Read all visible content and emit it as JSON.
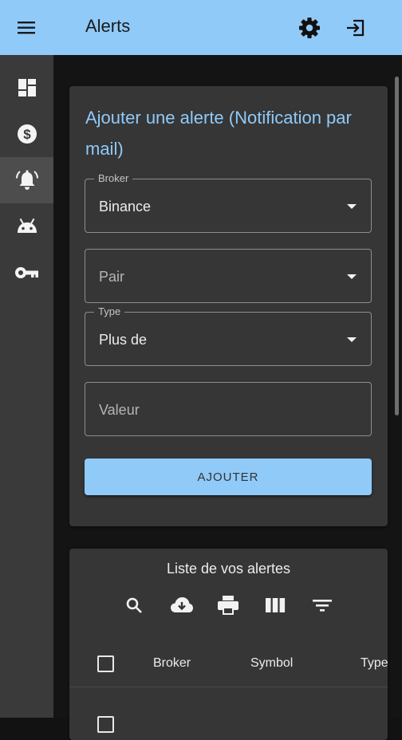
{
  "appbar": {
    "title": "Alerts",
    "menu_icon": "hamburger-menu-icon",
    "settings_icon": "gear-icon",
    "logout_icon": "logout-icon",
    "background": "#90caf9"
  },
  "sidebar": {
    "items": [
      {
        "icon": "dashboard-icon",
        "active": false
      },
      {
        "icon": "dollar-icon",
        "active": false
      },
      {
        "icon": "alarm-bell-icon",
        "active": true
      },
      {
        "icon": "android-robot-icon",
        "active": false
      },
      {
        "icon": "key-icon",
        "active": false
      }
    ]
  },
  "form": {
    "title": "Ajouter une alerte (Notification par mail)",
    "broker": {
      "label": "Broker",
      "value": "Binance"
    },
    "pair": {
      "placeholder": "Pair"
    },
    "type": {
      "label": "Type",
      "value": "Plus de"
    },
    "valeur": {
      "placeholder": "Valeur"
    },
    "submit_label": "AJOUTER",
    "accent": "#90caf9"
  },
  "list": {
    "title": "Liste de vos alertes",
    "toolbar": [
      "search-icon",
      "cloud-download-icon",
      "print-icon",
      "view-columns-icon",
      "filter-icon"
    ],
    "columns": [
      "Broker",
      "Symbol",
      "Type"
    ]
  }
}
